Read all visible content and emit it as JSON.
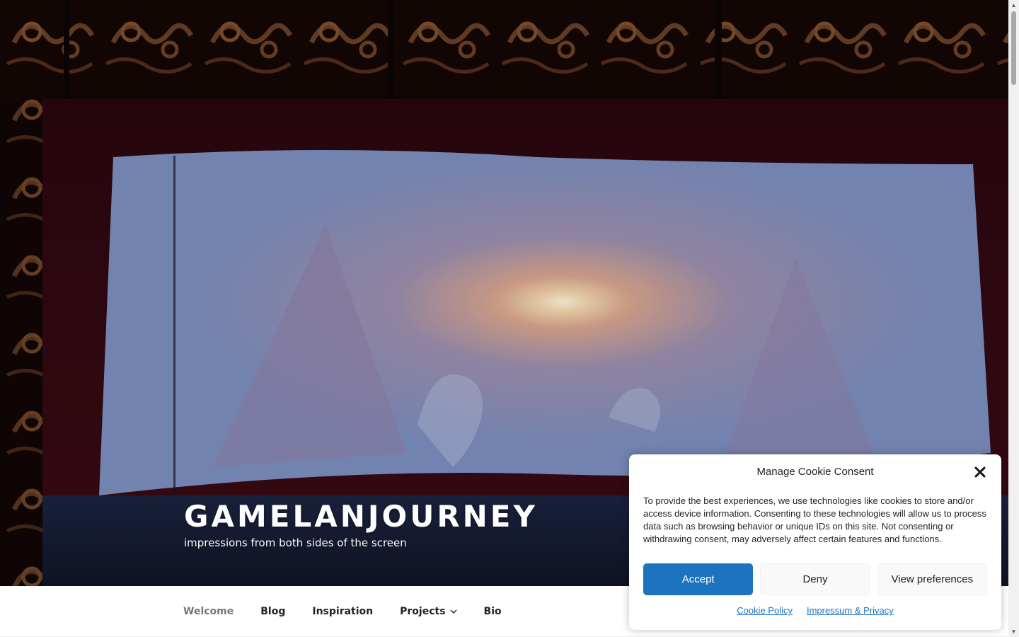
{
  "header": {
    "site_title": "GAMELANJOURNEY",
    "site_description": "impressions from both sides of the screen",
    "image_subject": "wayang-shadow-puppet-screen"
  },
  "navigation": {
    "items": [
      {
        "label": "Welcome",
        "current": true
      },
      {
        "label": "Blog"
      },
      {
        "label": "Inspiration"
      },
      {
        "label": "Projects",
        "has_submenu": true
      },
      {
        "label": "Bio"
      }
    ],
    "submenu_icon": "chevron-down-icon"
  },
  "cookie_banner": {
    "title": "Manage Cookie Consent",
    "close_icon": "close-icon",
    "message": "To provide the best experiences, we use technologies like cookies to store and/or access device information. Consenting to these technologies will allow us to process data such as browsing behavior or unique IDs on this site. Not consenting or withdrawing consent, may adversely affect certain features and functions.",
    "buttons": {
      "accept": "Accept",
      "deny": "Deny",
      "preferences": "View preferences"
    },
    "links": {
      "cookie_policy": "Cookie Policy",
      "impressum": "Impressum & Privacy"
    },
    "accent_color": "#1e73be"
  },
  "colors": {
    "nav_current": "#767676",
    "nav_text": "#222222",
    "link": "#1e73be"
  }
}
